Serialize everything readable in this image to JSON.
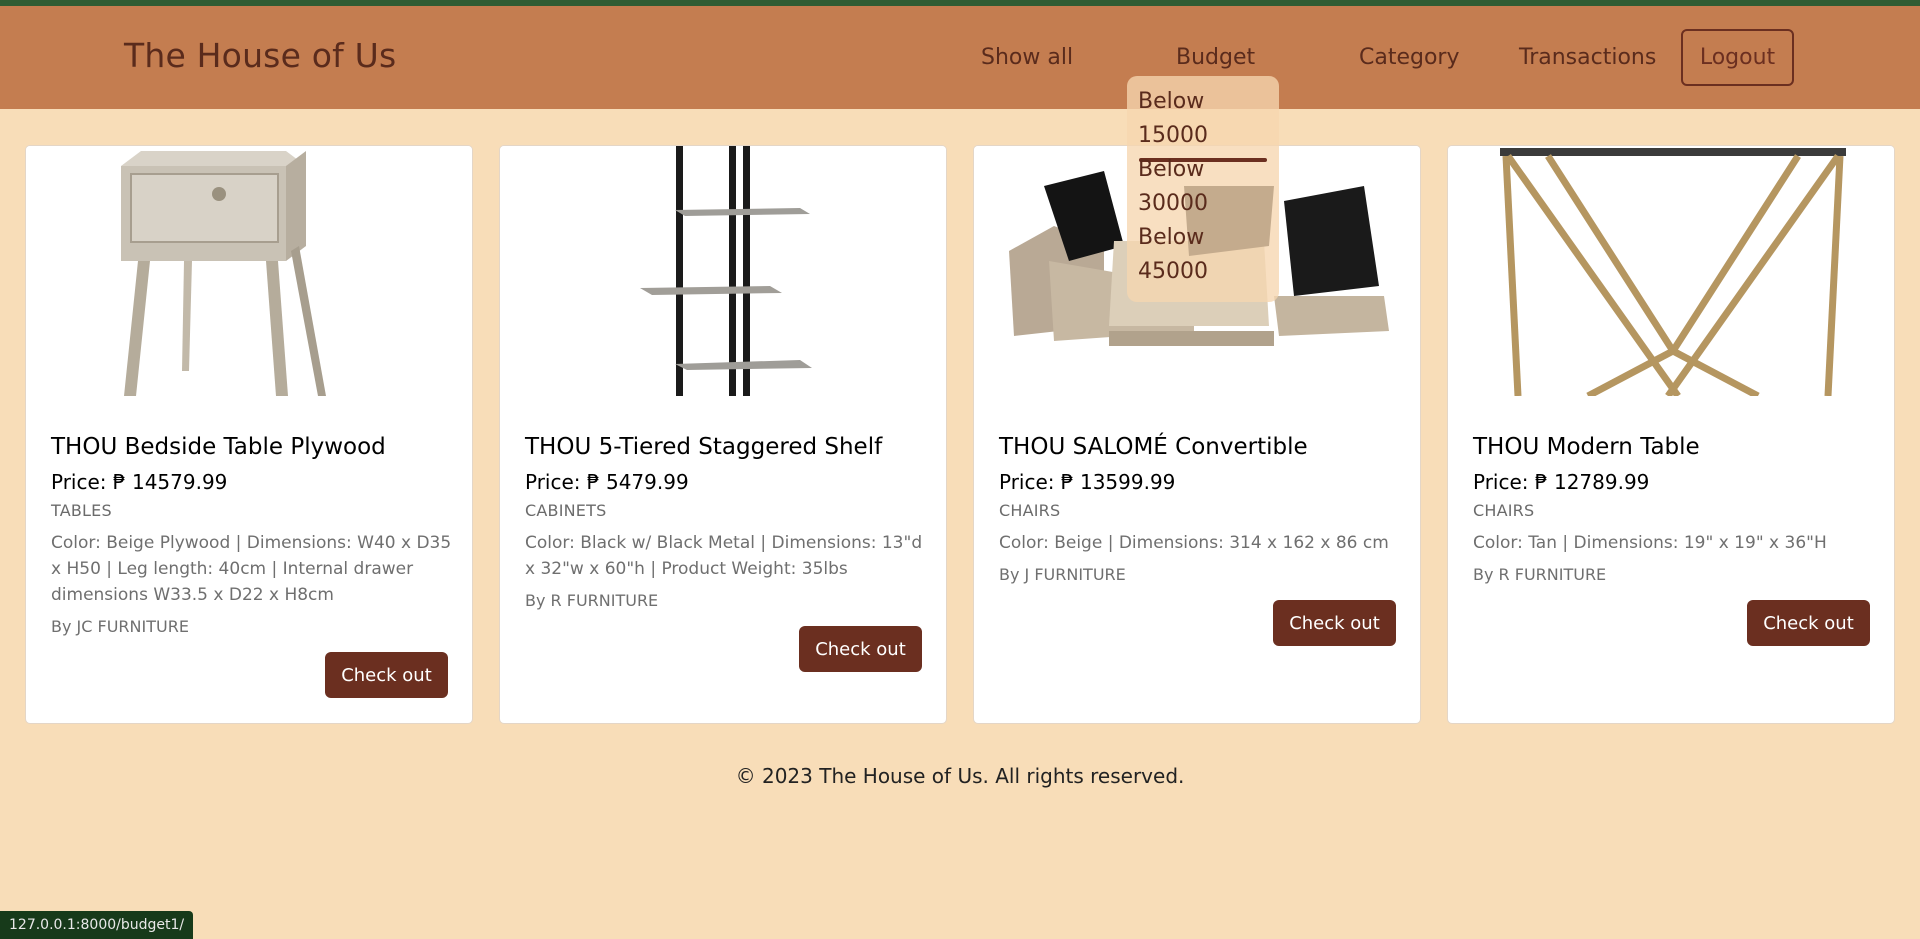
{
  "header": {
    "brand": "The House of Us",
    "nav": {
      "show_all": "Show all",
      "budget": "Budget",
      "category": "Category",
      "transactions": "Transactions",
      "logout": "Logout"
    }
  },
  "budget_dropdown": {
    "items": [
      {
        "line1": "Below",
        "line2": "15000"
      },
      {
        "line1": "Below",
        "line2": "30000"
      },
      {
        "line1": "Below",
        "line2": "45000"
      }
    ]
  },
  "products": [
    {
      "title": "THOU Bedside Table Plywood",
      "price_label": "Price: ₱ 14579.99",
      "category": "TABLES",
      "description": "Color: Beige Plywood | Dimensions: W40 x D35 x H50 | Leg length: 40cm | Internal drawer dimensions W33.5 x D22 x H8cm",
      "seller": "By JC FURNITURE",
      "button": "Check out"
    },
    {
      "title": "THOU 5-Tiered Staggered Shelf",
      "price_label": "Price: ₱ 5479.99",
      "category": "CABINETS",
      "description": "Color: Black w/ Black Metal | Dimensions: 13\"d x 32\"w x 60\"h | Product Weight: 35lbs",
      "seller": "By R FURNITURE",
      "button": "Check out"
    },
    {
      "title": "THOU SALOMÉ Convertible",
      "price_label": "Price: ₱ 13599.99",
      "category": "CHAIRS",
      "description": "Color: Beige | Dimensions: 314 x 162 x 86 cm",
      "seller": "By J FURNITURE",
      "button": "Check out"
    },
    {
      "title": "THOU Modern Table",
      "price_label": "Price: ₱ 12789.99",
      "category": "CHAIRS",
      "description": "Color: Tan | Dimensions: 19\" x 19\" x 36\"H",
      "seller": "By R FURNITURE",
      "button": "Check out"
    }
  ],
  "footer": {
    "text": "© 2023 The House of Us. All rights reserved."
  },
  "status_bar": {
    "url": "127.0.0.1:8000/budget1/"
  },
  "colors": {
    "background": "#f8ddb8",
    "navbar": "#c47d50",
    "brand_text": "#5a2b1c",
    "button": "#6b2f20",
    "top_strip": "#2f5d34"
  }
}
